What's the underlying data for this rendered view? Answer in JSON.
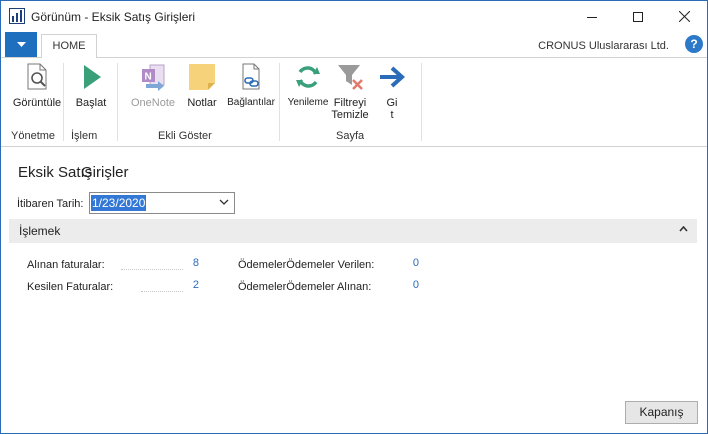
{
  "window": {
    "title": "Görünüm - Eksik Satış Girişleri",
    "app_icon": "dynamics-nav-icon"
  },
  "ribbon": {
    "tab": "HOME",
    "company": "CRONUS Uluslararası Ltd.",
    "buttons": {
      "goruntule": "Görüntüle",
      "baslat": "Başlat",
      "onenote": "OneNote",
      "notlar": "Notlar",
      "baglantilar": "Bağlantılar",
      "yenileme": "Yenileme",
      "filtreyi_1": "Filtreyi",
      "filtreyi_2": "Temizle",
      "git_1": "Gi",
      "git_2": "t"
    },
    "groups": {
      "yonetme": "Yönetme",
      "islem": "İşlem",
      "ekli_goster": "Ekli Göster",
      "sayfa": "Sayfa"
    }
  },
  "page": {
    "title_part1": "Eksik Satış",
    "title_part2": "Girişler",
    "date_label": "İtibaren Tarih:",
    "date_value": "1/23/2020",
    "section_title": "İşlemek",
    "fields_left": [
      {
        "label": "Alınan faturalar:",
        "value": "8"
      },
      {
        "label": "Kesilen Faturalar:",
        "value": "2"
      }
    ],
    "fields_right": [
      {
        "label": "ÖdemelerÖdemeler Verilen:",
        "value": "0"
      },
      {
        "label": "ÖdemelerÖdemeler Alınan:",
        "value": "0"
      }
    ],
    "close_label": "Kapanış"
  },
  "colors": {
    "accent": "#1f6fbf",
    "link": "#2b6cb8",
    "selection": "#3478d6"
  }
}
